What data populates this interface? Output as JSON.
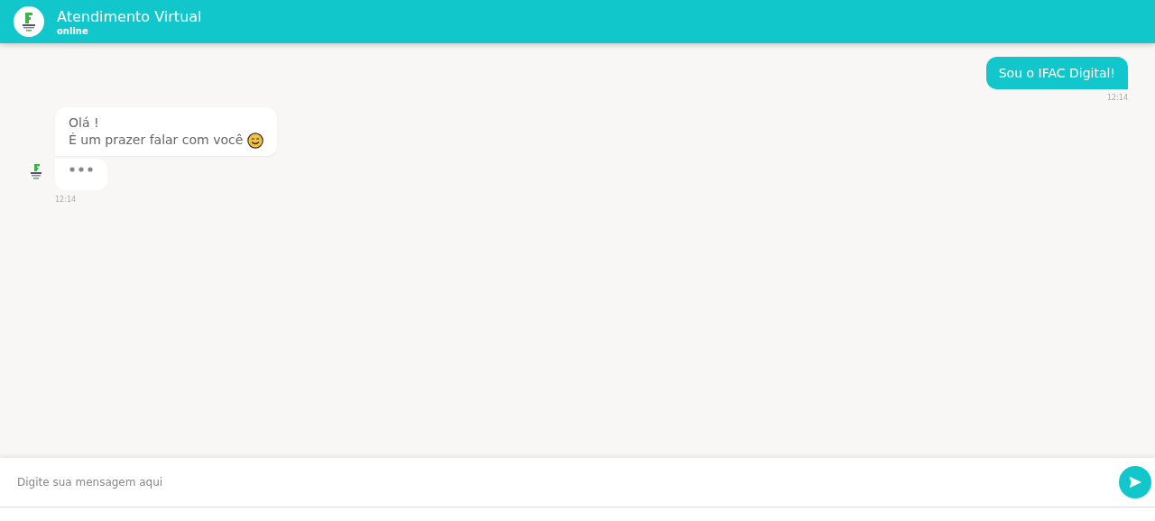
{
  "header": {
    "title": "Atendimento Virtual",
    "status": "online"
  },
  "messages": [
    {
      "kind": "user",
      "lines": [
        "Sou o IFAC Digital!"
      ],
      "time": "12:14"
    },
    {
      "kind": "bot",
      "lines": [
        "Olá !",
        "É um prazer falar com você"
      ],
      "emoji": true,
      "typing": true,
      "time": "12:14"
    }
  ],
  "composer": {
    "placeholder": "Digite sua mensagem aqui"
  }
}
